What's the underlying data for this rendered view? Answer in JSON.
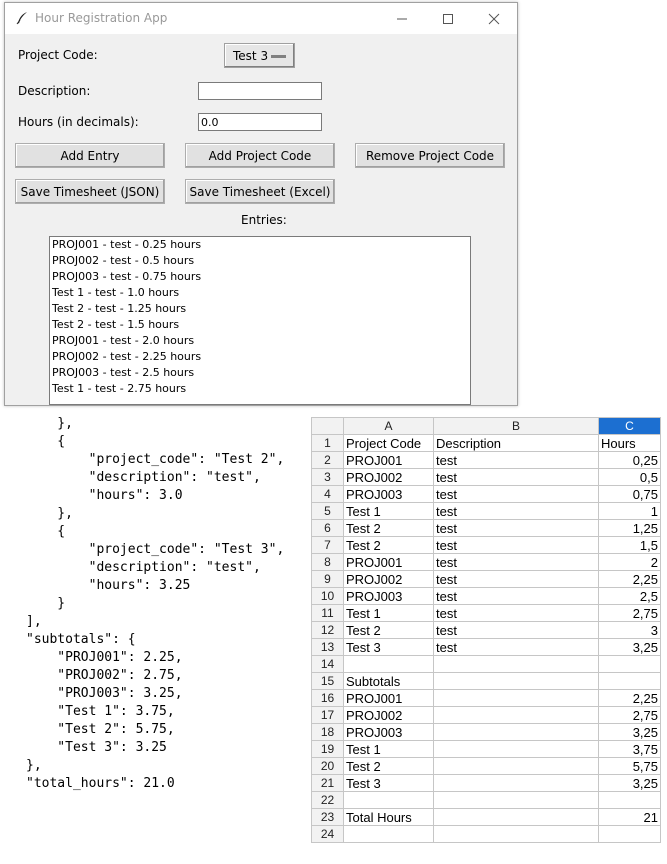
{
  "window": {
    "title": "Hour Registration App",
    "project_code_label": "Project Code:",
    "project_code_selected": "Test 3",
    "description_label": "Description:",
    "description_value": "",
    "hours_label": "Hours (in decimals):",
    "hours_value": "0.0",
    "buttons": {
      "add_entry": "Add Entry",
      "add_project_code": "Add Project Code",
      "remove_project_code": "Remove Project Code",
      "save_json": "Save Timesheet (JSON)",
      "save_excel": "Save Timesheet (Excel)"
    },
    "entries_label": "Entries:",
    "entries": [
      "PROJ001 - test - 0.25 hours",
      "PROJ002 - test - 0.5 hours",
      "PROJ003 - test  - 0.75 hours",
      "Test 1 - test - 1.0 hours",
      "Test 2 - test - 1.25 hours",
      "Test 2 - test - 1.5 hours",
      "PROJ001 - test - 2.0 hours",
      "PROJ002 - test - 2.25 hours",
      "PROJ003 - test  - 2.5 hours",
      "Test 1 - test - 2.75 hours"
    ],
    "icons": [
      "feather-icon",
      "minimize-icon",
      "maximize-icon",
      "close-icon"
    ]
  },
  "json_view": {
    "lines": [
      "    },",
      "    {",
      "        \"project_code\": \"Test 2\",",
      "        \"description\": \"test\",",
      "        \"hours\": 3.0",
      "    },",
      "    {",
      "        \"project_code\": \"Test 3\",",
      "        \"description\": \"test\",",
      "        \"hours\": 3.25",
      "    }",
      "],",
      "\"subtotals\": {",
      "    \"PROJ001\": 2.25,",
      "    \"PROJ002\": 2.75,",
      "    \"PROJ003\": 3.25,",
      "    \"Test 1\": 3.75,",
      "    \"Test 2\": 5.75,",
      "    \"Test 3\": 3.25",
      "},",
      "\"total_hours\": 21.0"
    ]
  },
  "spreadsheet": {
    "columns": [
      "A",
      "B",
      "C"
    ],
    "selected_column": "C",
    "rows": [
      [
        "1",
        "Project Code",
        "Description",
        "Hours"
      ],
      [
        "2",
        "PROJ001",
        "test",
        "0,25"
      ],
      [
        "3",
        "PROJ002",
        "test",
        "0,5"
      ],
      [
        "4",
        "PROJ003",
        "test",
        "0,75"
      ],
      [
        "5",
        "Test 1",
        "test",
        "1"
      ],
      [
        "6",
        "Test 2",
        "test",
        "1,25"
      ],
      [
        "7",
        "Test 2",
        "test",
        "1,5"
      ],
      [
        "8",
        "PROJ001",
        "test",
        "2"
      ],
      [
        "9",
        "PROJ002",
        "test",
        "2,25"
      ],
      [
        "10",
        "PROJ003",
        "test",
        "2,5"
      ],
      [
        "11",
        "Test 1",
        "test",
        "2,75"
      ],
      [
        "12",
        "Test 2",
        "test",
        "3"
      ],
      [
        "13",
        "Test 3",
        "test",
        "3,25"
      ],
      [
        "14",
        "",
        "",
        ""
      ],
      [
        "15",
        "Subtotals",
        "",
        ""
      ],
      [
        "16",
        "PROJ001",
        "",
        "2,25"
      ],
      [
        "17",
        "PROJ002",
        "",
        "2,75"
      ],
      [
        "18",
        "PROJ003",
        "",
        "3,25"
      ],
      [
        "19",
        "Test 1",
        "",
        "3,75"
      ],
      [
        "20",
        "Test 2",
        "",
        "5,75"
      ],
      [
        "21",
        "Test 3",
        "",
        "3,25"
      ],
      [
        "22",
        "",
        "",
        ""
      ],
      [
        "23",
        "Total Hours",
        "",
        "21"
      ],
      [
        "24",
        "",
        "",
        ""
      ]
    ]
  }
}
